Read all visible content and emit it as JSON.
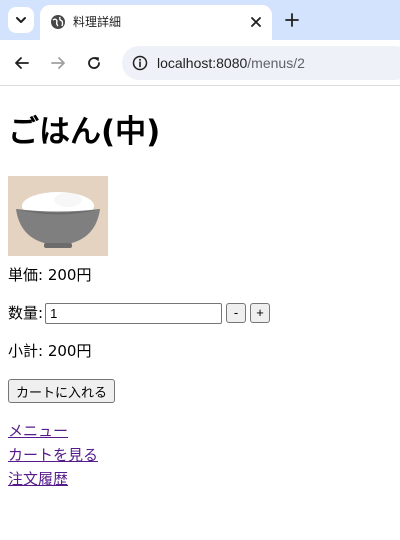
{
  "browser": {
    "tab": {
      "title": "料理詳細"
    },
    "url": {
      "host": "localhost:8080",
      "path": "/menus/2"
    },
    "icons": {
      "tab_search": "chevron-down-icon",
      "favicon": "globe-icon",
      "close": "close-icon",
      "new_tab": "plus-icon",
      "back": "arrow-left-icon",
      "forward": "arrow-right-icon",
      "reload": "reload-icon",
      "site_info": "info-icon"
    }
  },
  "page": {
    "title": "ごはん(中)",
    "image": {
      "alt": "ごはん(中)",
      "description": "bowl-of-rice-illustration"
    },
    "unit_price": "単価: 200円",
    "quantity": {
      "label": "数量:",
      "value": "1",
      "decrement": "-",
      "increment": "+"
    },
    "subtotal": "小計: 200円",
    "add_to_cart": "カートに入れる",
    "links": [
      {
        "label": "メニュー"
      },
      {
        "label": "カートを見る"
      },
      {
        "label": "注文履歴"
      }
    ]
  },
  "colors": {
    "tabstrip": "#d3e3fd",
    "link_visited": "#551a8b",
    "image_bg": "#e4d3c1",
    "bowl": "#7f7f7f",
    "rice": "#ffffff"
  }
}
